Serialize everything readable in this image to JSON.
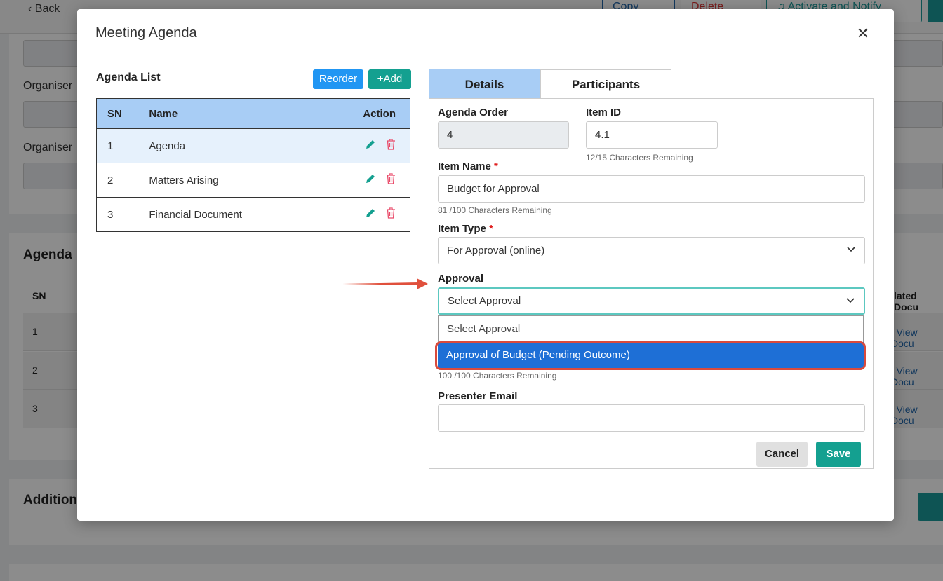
{
  "background": {
    "back_label": "Back",
    "copy_label": "Copy",
    "delete_label": "Delete",
    "activate_label": "Activate and Notify",
    "organiser_label_1": "Organiser",
    "organiser_label_2": "Organiser",
    "agenda_heading": "Agenda",
    "sn_header": "SN",
    "rows": [
      "1",
      "2",
      "3"
    ],
    "related_docs_header": "lated Docu",
    "view_doc_link": "| View Docu",
    "additional_heading": "Addition"
  },
  "modal": {
    "title": "Meeting Agenda",
    "close_icon": "close-icon"
  },
  "agenda_list": {
    "title": "Agenda List",
    "reorder_label": "Reorder",
    "add_label": "Add",
    "columns": {
      "sn": "SN",
      "name": "Name",
      "action": "Action"
    },
    "rows": [
      {
        "sn": "1",
        "name": "Agenda"
      },
      {
        "sn": "2",
        "name": "Matters Arising"
      },
      {
        "sn": "3",
        "name": "Financial Document"
      }
    ]
  },
  "tabs": {
    "details": "Details",
    "participants": "Participants"
  },
  "form": {
    "agenda_order_label": "Agenda Order",
    "agenda_order_value": "4",
    "item_id_label": "Item ID",
    "item_id_value": "4.1",
    "item_id_hint": "12/15 Characters Remaining",
    "item_name_label": "Item Name",
    "item_name_value": "Budget for Approval",
    "item_name_hint": "81 /100 Characters Remaining",
    "item_type_label": "Item Type",
    "item_type_value": "For Approval (online)",
    "approval_label": "Approval",
    "approval_value": "Select Approval",
    "approval_options": [
      "Select Approval",
      "Approval of Budget (Pending Outcome)"
    ],
    "description_hint": "100 /100 Characters Remaining",
    "presenter_email_label": "Presenter Email",
    "presenter_email_value": "",
    "required_mark": "*",
    "cancel_label": "Cancel",
    "save_label": "Save"
  },
  "colors": {
    "accent_teal": "#14a090",
    "accent_blue": "#2196f3",
    "header_blue": "#a8cdf5",
    "highlight": "#1e6fd6",
    "annotation_red": "#d94a3c"
  }
}
